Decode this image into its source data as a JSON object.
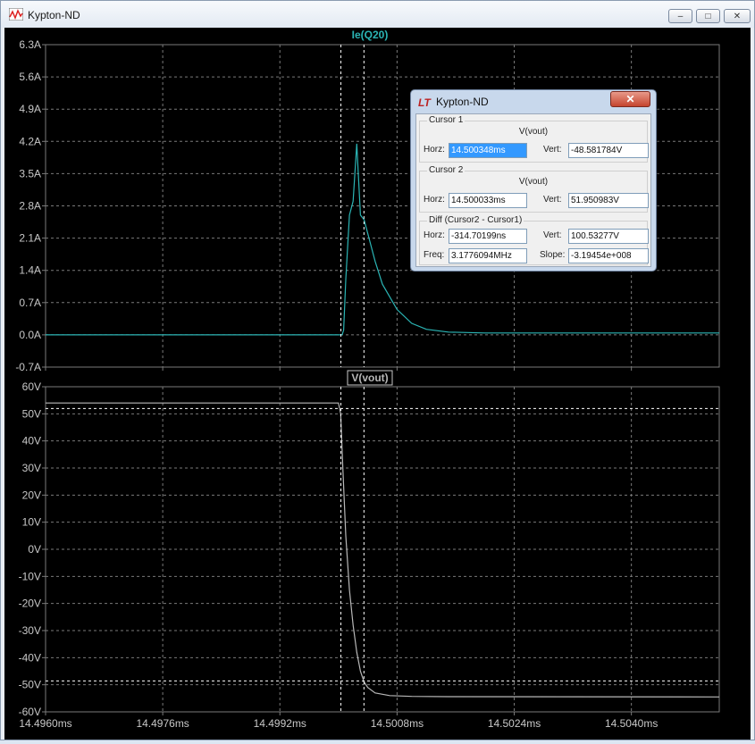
{
  "window": {
    "title": "Kypton-ND",
    "minimize": "–",
    "maximize": "□",
    "close": "✕"
  },
  "dialog": {
    "title": "Kypton-ND",
    "logo": "LT",
    "close": "✕",
    "cursor1": {
      "legend": "Cursor 1",
      "trace": "V(vout)",
      "horz_label": "Horz:",
      "horz": "14.500348ms",
      "vert_label": "Vert:",
      "vert": "-48.581784V"
    },
    "cursor2": {
      "legend": "Cursor 2",
      "trace": "V(vout)",
      "horz_label": "Horz:",
      "horz": "14.500033ms",
      "vert_label": "Vert:",
      "vert": "51.950983V"
    },
    "diff": {
      "legend": "Diff (Cursor2 - Cursor1)",
      "horz_label": "Horz:",
      "horz": "-314.70199ns",
      "vert_label": "Vert:",
      "vert": "100.53277V",
      "freq_label": "Freq:",
      "freq": "3.1776094MHz",
      "slope_label": "Slope:",
      "slope": "-3.19454e+008"
    }
  },
  "colors": {
    "background": "#000000",
    "grid": "#7a7a7a",
    "trace_current": "#2bb5b5",
    "trace_voltage": "#b8b8b8",
    "cursor": "#ffffff"
  },
  "chart_data": [
    {
      "type": "line",
      "title": "Ie(Q20)",
      "x_unit": "ms",
      "xlim": [
        14.496,
        14.5052
      ],
      "x_ticks": [],
      "ylim": [
        -0.7,
        6.3
      ],
      "y_ticks": [
        "6.3A",
        "5.6A",
        "4.9A",
        "4.2A",
        "3.5A",
        "2.8A",
        "2.1A",
        "1.4A",
        "0.7A",
        "0.0A",
        "-0.7A"
      ],
      "y_tick_values": [
        6.3,
        5.6,
        4.9,
        4.2,
        3.5,
        2.8,
        2.1,
        1.4,
        0.7,
        0.0,
        -0.7
      ],
      "grid": true,
      "series": [
        {
          "name": "Ie(Q20)",
          "x": [
            14.496,
            14.50005,
            14.50007,
            14.5001,
            14.50015,
            14.5002,
            14.50025,
            14.50027,
            14.5003,
            14.50035,
            14.5004,
            14.5005,
            14.5006,
            14.5008,
            14.501,
            14.5012,
            14.5015,
            14.502,
            14.503,
            14.504,
            14.5052
          ],
          "y": [
            0.0,
            0.0,
            0.1,
            1.2,
            2.6,
            2.9,
            4.15,
            3.5,
            2.6,
            2.5,
            2.2,
            1.6,
            1.1,
            0.55,
            0.25,
            0.12,
            0.06,
            0.04,
            0.04,
            0.04,
            0.04
          ]
        }
      ],
      "cursors_x": [
        14.500033,
        14.500348
      ]
    },
    {
      "type": "line",
      "title": "V(vout)",
      "x_unit": "ms",
      "xlim": [
        14.496,
        14.5052
      ],
      "x_ticks": [
        "14.4960ms",
        "14.4976ms",
        "14.4992ms",
        "14.5008ms",
        "14.5024ms",
        "14.5040ms"
      ],
      "x_tick_values": [
        14.496,
        14.4976,
        14.4992,
        14.5008,
        14.5024,
        14.504
      ],
      "ylim": [
        -60,
        60
      ],
      "y_ticks": [
        "60V",
        "50V",
        "40V",
        "30V",
        "20V",
        "10V",
        "0V",
        "-10V",
        "-20V",
        "-30V",
        "-40V",
        "-50V",
        "-60V"
      ],
      "y_tick_values": [
        60,
        50,
        40,
        30,
        20,
        10,
        0,
        -10,
        -20,
        -30,
        -40,
        -50,
        -60
      ],
      "grid": true,
      "series": [
        {
          "name": "V(vout)",
          "x": [
            14.496,
            14.5,
            14.50003,
            14.50006,
            14.5001,
            14.50015,
            14.5002,
            14.50025,
            14.5003,
            14.50035,
            14.5004,
            14.5005,
            14.5007,
            14.501,
            14.5015,
            14.5052
          ],
          "y": [
            54,
            54,
            50,
            30,
            5,
            -15,
            -28,
            -38,
            -45,
            -49,
            -51,
            -53,
            -54,
            -54.3,
            -54.4,
            -54.5
          ]
        }
      ],
      "cursors_x": [
        14.500033,
        14.500348
      ],
      "cursors_y": [
        51.950983,
        -48.581784
      ]
    }
  ]
}
